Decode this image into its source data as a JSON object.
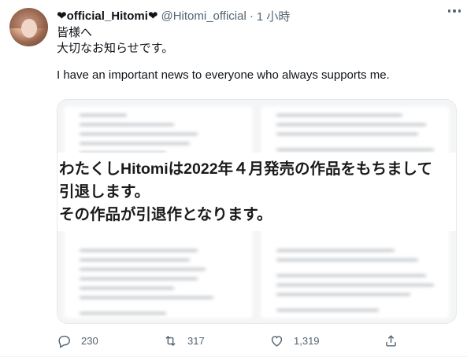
{
  "tweet": {
    "display_name": "❤official_Hitomi❤",
    "handle": "@Hitomi_official",
    "separator": "·",
    "time": "1 小時",
    "body": {
      "line1": "皆様へ",
      "line2": "大切なお知らせです。",
      "line3": "I have an important news to everyone who always supports me."
    },
    "image": {
      "overlay_line1": "わたくしHitomiは2022年４月発売の作品をもちまして",
      "overlay_line2": "引退します。",
      "overlay_line3": "その作品が引退作となります。"
    },
    "actions": {
      "reply_icon": "reply-icon",
      "reply_count": "230",
      "retweet_icon": "retweet-icon",
      "retweet_count": "317",
      "like_icon": "heart-icon",
      "like_count": "1,319",
      "share_icon": "share-icon"
    }
  },
  "colors": {
    "text_primary": "#0f1419",
    "text_secondary": "#536471",
    "border": "#eff3f4"
  }
}
